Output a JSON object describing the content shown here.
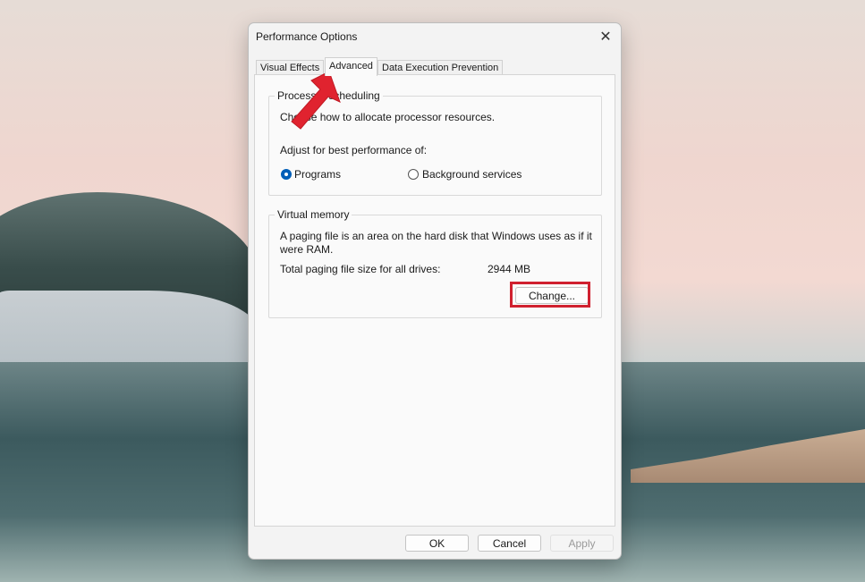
{
  "window": {
    "title": "Performance Options"
  },
  "tabs": [
    {
      "label": "Visual Effects"
    },
    {
      "label": "Advanced"
    },
    {
      "label": "Data Execution Prevention"
    }
  ],
  "processor": {
    "group_label": "Processor scheduling",
    "description": "Choose how to allocate processor resources.",
    "adjust_label": "Adjust for best performance of:",
    "options": [
      {
        "label": "Programs",
        "checked": true
      },
      {
        "label": "Background services",
        "checked": false
      }
    ]
  },
  "virtual_memory": {
    "group_label": "Virtual memory",
    "description_line1": "A paging file is an area on the hard disk that Windows uses as if it",
    "description_line2": "were RAM.",
    "total_label": "Total paging file size for all drives:",
    "total_value": "2944 MB",
    "change_label": "Change..."
  },
  "footer": {
    "ok": "OK",
    "cancel": "Cancel",
    "apply": "Apply"
  },
  "annotation": {
    "color": "#d0202f"
  }
}
